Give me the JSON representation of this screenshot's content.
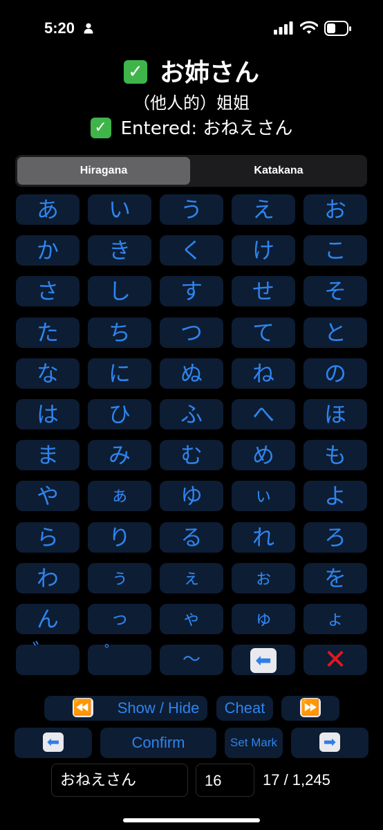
{
  "status": {
    "time": "5:20"
  },
  "header": {
    "check": "✓",
    "word": "お姉さん",
    "meaning": "（他人的）姐姐",
    "entered_label": "Entered: おねえさん"
  },
  "tabs": [
    {
      "label": "Hiragana",
      "selected": true
    },
    {
      "label": "Katakana",
      "selected": false
    }
  ],
  "kana_rows": [
    [
      "あ",
      "い",
      "う",
      "え",
      "お"
    ],
    [
      "か",
      "き",
      "く",
      "け",
      "こ"
    ],
    [
      "さ",
      "し",
      "す",
      "せ",
      "そ"
    ],
    [
      "た",
      "ち",
      "つ",
      "て",
      "と"
    ],
    [
      "な",
      "に",
      "ぬ",
      "ね",
      "の"
    ],
    [
      "は",
      "ひ",
      "ふ",
      "へ",
      "ほ"
    ],
    [
      "ま",
      "み",
      "む",
      "め",
      "も"
    ],
    [
      "や",
      "ぁ",
      "ゆ",
      "ぃ",
      "よ"
    ],
    [
      "ら",
      "り",
      "る",
      "れ",
      "ろ"
    ],
    [
      "わ",
      "ぅ",
      "ぇ",
      "ぉ",
      "を"
    ],
    [
      "ん",
      "っ",
      "ゃ",
      "ゅ",
      "ょ"
    ]
  ],
  "last_row": {
    "dakuten": "゛",
    "handakuten": "゜",
    "long_mark": "～",
    "backspace_icon": "⬅",
    "clear_icon": "✕"
  },
  "controls": {
    "rewind_icon": "⏪",
    "show_hide": "Show / Hide",
    "cheat": "Cheat",
    "forward_icon": "⏩",
    "prev_icon": "⬅",
    "confirm": "Confirm",
    "set_mark": "Set Mark",
    "next_icon": "➡"
  },
  "input": {
    "answer": "おねえさん",
    "index": "16",
    "progress": "17 / 1,245"
  },
  "colors": {
    "key_bg": "#0d1d33",
    "key_text": "#2e84ee",
    "check_bg": "#3fb44a",
    "clear": "#e0191f"
  }
}
